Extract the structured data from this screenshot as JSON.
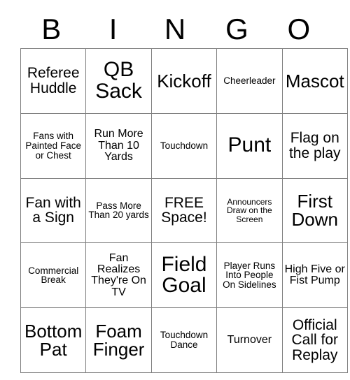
{
  "card": {
    "title": "BINGO",
    "headers": [
      "B",
      "I",
      "N",
      "G",
      "O"
    ],
    "free_space_label": "FREE Space!",
    "rows": [
      [
        {
          "text": "Referee Huddle",
          "size": "fs-md"
        },
        {
          "text": "QB Sack",
          "size": "fs-xl"
        },
        {
          "text": "Kickoff",
          "size": "fs-lg"
        },
        {
          "text": "Cheerleader",
          "size": "fs-xs"
        },
        {
          "text": "Mascot",
          "size": "fs-lg"
        }
      ],
      [
        {
          "text": "Fans with Painted Face or Chest",
          "size": "fs-xs"
        },
        {
          "text": "Run More Than 10 Yards",
          "size": "fs-sm"
        },
        {
          "text": "Touchdown",
          "size": "fs-xs"
        },
        {
          "text": "Punt",
          "size": "fs-xl"
        },
        {
          "text": "Flag on the play",
          "size": "fs-md"
        }
      ],
      [
        {
          "text": "Fan with a Sign",
          "size": "fs-md"
        },
        {
          "text": "Pass More Than 20 yards",
          "size": "fs-xs"
        },
        {
          "text": "FREE Space!",
          "size": "fs-md"
        },
        {
          "text": "Announcers Draw on the Screen",
          "size": "fs-xxs"
        },
        {
          "text": "First Down",
          "size": "fs-lg"
        }
      ],
      [
        {
          "text": "Commercial Break",
          "size": "fs-xs"
        },
        {
          "text": "Fan Realizes They're On TV",
          "size": "fs-sm"
        },
        {
          "text": "Field Goal",
          "size": "fs-xl"
        },
        {
          "text": "Player Runs Into People On Sidelines",
          "size": "fs-xs"
        },
        {
          "text": "High Five or Fist Pump",
          "size": "fs-sm"
        }
      ],
      [
        {
          "text": "Bottom Pat",
          "size": "fs-lg"
        },
        {
          "text": "Foam Finger",
          "size": "fs-lg"
        },
        {
          "text": "Touchdown Dance",
          "size": "fs-xs"
        },
        {
          "text": "Turnover",
          "size": "fs-sm"
        },
        {
          "text": "Official Call for Replay",
          "size": "fs-md"
        }
      ]
    ]
  },
  "colors": {
    "background": "#ffffff",
    "text": "#000000",
    "border": "#808080"
  }
}
